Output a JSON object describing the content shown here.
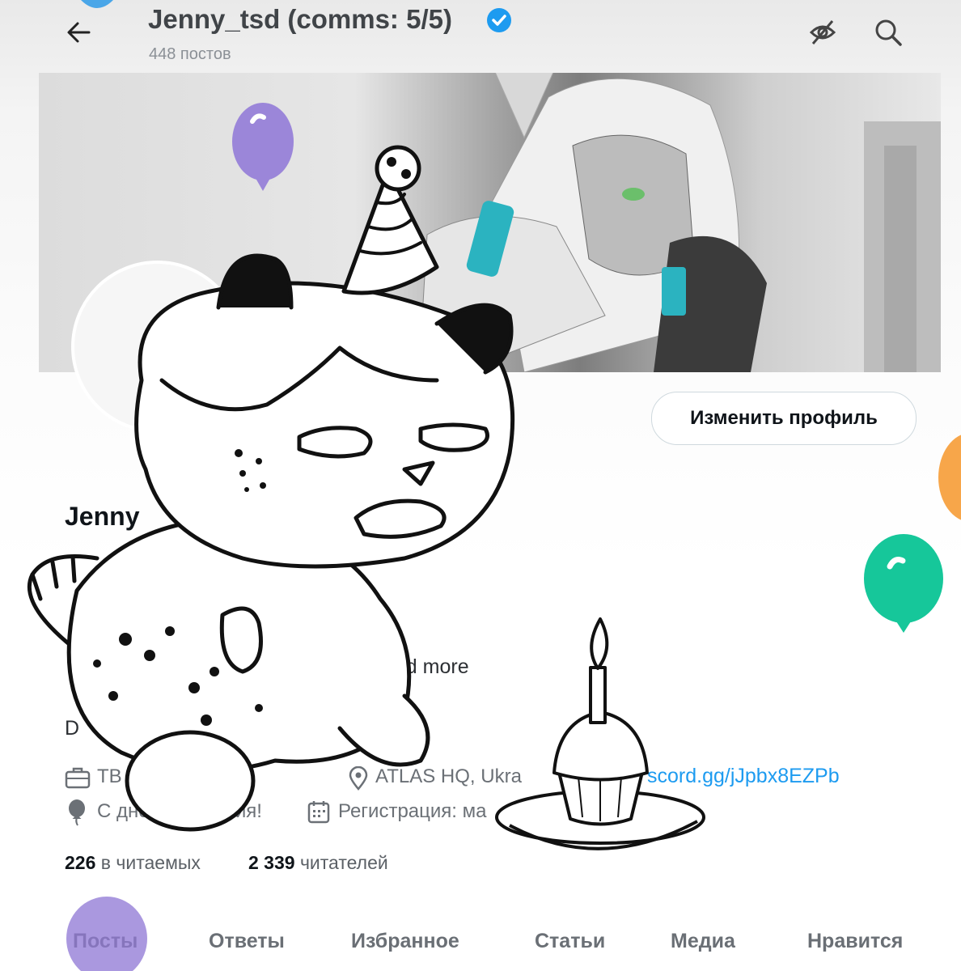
{
  "header": {
    "title": "Jenny_tsd (comms: 5/5)",
    "post_count": "448 постов"
  },
  "profile": {
    "name": "Jenny",
    "edit_button": "Изменить профиль",
    "bio_fragment": "and more",
    "bio_line2": "D"
  },
  "meta": {
    "job": "TB",
    "location": "ATLAS HQ, Ukra",
    "link": "scord.gg/jJpbx8EZPb",
    "birthday": "С днем рождения!",
    "joined": "Регистрация: ма"
  },
  "stats": {
    "following_count": "226",
    "following_label": "в читаемых",
    "followers_count": "2 339",
    "followers_label": "читателей"
  },
  "tabs": [
    {
      "label": "Посты",
      "active": true
    },
    {
      "label": "Ответы"
    },
    {
      "label": "Избранное"
    },
    {
      "label": "Статьи"
    },
    {
      "label": "Медиа"
    },
    {
      "label": "Нравится"
    }
  ],
  "colors": {
    "accent": "#1d9bf0",
    "balloon_purple": "#9b86d9",
    "balloon_green": "#16c79a",
    "balloon_orange": "#f7a64a",
    "controller_cyan": "#2bb3c0"
  },
  "icons": {
    "back": "arrow-left-icon",
    "verified": "verified-badge-icon",
    "hide": "eye-off-icon",
    "search": "search-icon",
    "job": "briefcase-icon",
    "location": "location-pin-icon",
    "birthday": "balloon-icon",
    "joined": "calendar-icon"
  }
}
